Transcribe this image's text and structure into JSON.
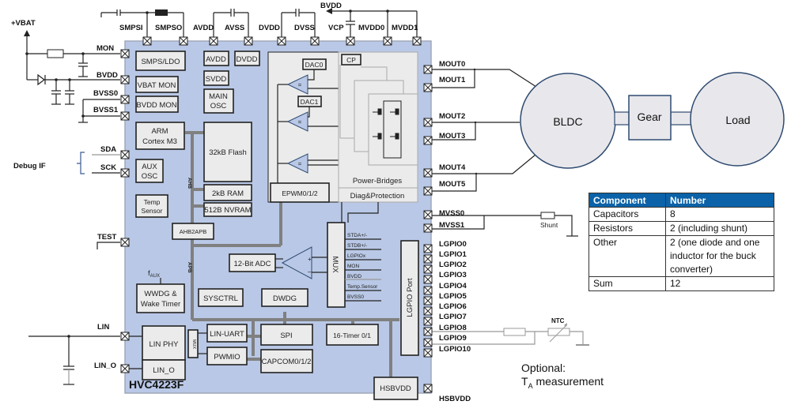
{
  "chip": {
    "name": "HVC4223F",
    "blocks": {
      "smps_ldo": "SMPS/LDO",
      "vbat_mon": "VBAT MON",
      "bvdd_mon": "BVDD MON",
      "avdd": "AVDD",
      "dvdd": "DVDD",
      "svdd": "SVDD",
      "main_osc_1": "MAIN",
      "main_osc_2": "OSC",
      "arm_1": "ARM",
      "arm_2": "Cortex M3",
      "aux_osc_1": "AUX",
      "aux_osc_2": "OSC",
      "temp_sensor_1": "Temp",
      "temp_sensor_2": "Sensor",
      "flash": "32kB Flash",
      "ram": "2kB RAM",
      "nvram": "512B NVRAM",
      "ahb2apb": "AHB2APB",
      "ahb_bus": "AHB",
      "apb_bus": "APB",
      "dac0": "DAC0",
      "dac1": "DAC1",
      "comparator_symbol": "=",
      "epwm": "EPWM0/1/2",
      "cp": "CP",
      "power_bridges": "Power-Bridges",
      "diag_protection": "Diag&Protection",
      "adc": "12-Bit ADC",
      "mux": "MUX",
      "fau_x": "f",
      "fau_sub": "AUX",
      "wwdg_1": "WWDG &",
      "wwdg_2": "Wake Timer",
      "sysctrl": "SYSCTRL",
      "dwdg": "DWDG",
      "lgpio_port": "LGPIO Port",
      "lin_phy": "LIN PHY",
      "lin_o": "LIN_O",
      "lin_mux": "MUX",
      "lin_uart": "LIN-UART",
      "pwmio": "PWMIO",
      "spi": "SPI",
      "capcom": "CAPCOM0/1/2",
      "timer": "16-Timer 0/1",
      "hsbvdd": "HSBVDD"
    },
    "mux_inputs": [
      "STDA+/-",
      "STDB+/-",
      "LGPIOx",
      "MON",
      "BVDD",
      "Temp.Sensor",
      "BVSS0"
    ],
    "opamp_plus": "+",
    "opamp_minus": "–"
  },
  "pins": {
    "top": [
      "SMPSI",
      "SMPSO",
      "AVDD",
      "AVSS",
      "DVDD",
      "DVSS",
      "VCP",
      "MVDD0",
      "MVDD1"
    ],
    "left": [
      "MON",
      "BVDD",
      "BVSS0",
      "BVSS1",
      "SDA",
      "SCK",
      "TEST",
      "LIN",
      "LIN_O"
    ],
    "right_motor": [
      "MOUT0",
      "MOUT1",
      "MOUT2",
      "MOUT3",
      "MOUT4",
      "MOUT5"
    ],
    "right_supply": [
      "MVSS0",
      "MVSS1"
    ],
    "right_gpio": [
      "LGPIO0",
      "LGPIO1",
      "LGPIO2",
      "LGPIO3",
      "LGPIO4",
      "LGPIO5",
      "LGPIO6",
      "LGPIO7",
      "LGPIO8",
      "LGPIO9",
      "LGPIO10"
    ],
    "hsbvdd": "HSBVDD"
  },
  "external": {
    "vbat": "+VBAT",
    "bvdd_top": "BVDD",
    "debug_if": "Debug IF",
    "shunt": "Shunt",
    "ntc": "NTC",
    "bldc": "BLDC",
    "gear": "Gear",
    "load": "Load",
    "optional_line1": "Optional:",
    "optional_t": "T",
    "optional_sub": "A",
    "optional_rest": " measurement"
  },
  "table": {
    "headers": [
      "Component",
      "Number"
    ],
    "rows": [
      {
        "component": "Capacitors",
        "number": "8"
      },
      {
        "component": "Resistors",
        "number": "2 (including shunt)"
      },
      {
        "component": "Other",
        "number": "2 (one diode and one inductor for the buck converter)"
      },
      {
        "component": "Sum",
        "number": "12"
      }
    ]
  },
  "colors": {
    "chip_fill": "#b9c8e6",
    "block_fill": "#ebebeb",
    "table_header": "#0b62a8",
    "motor_fill": "#e8e8ec",
    "motor_stroke": "#2f4a70"
  }
}
